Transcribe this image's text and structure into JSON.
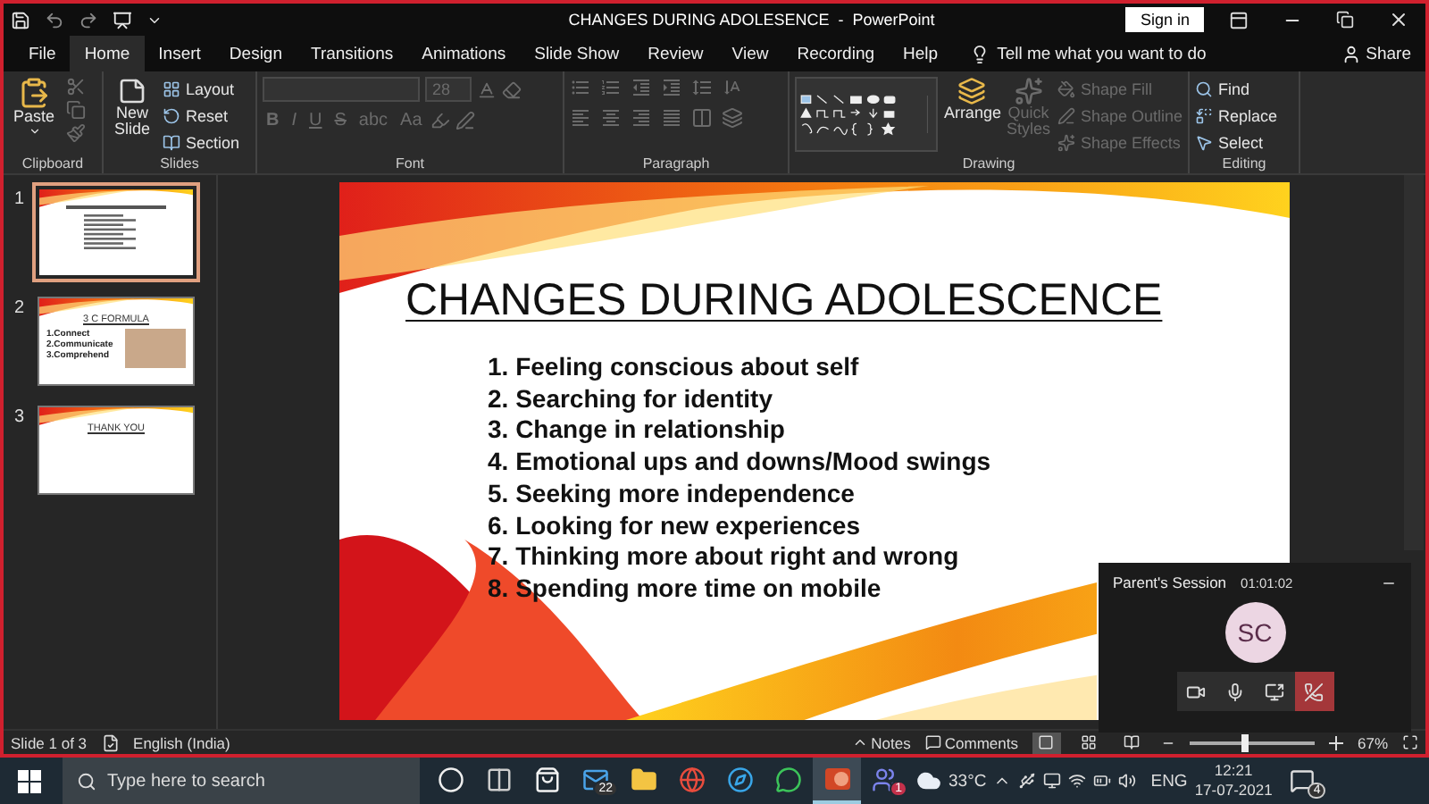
{
  "window": {
    "title": "CHANGES DURING ADOLESENCE  -  PowerPoint",
    "sign_in": "Sign in"
  },
  "tabs": [
    {
      "label": "File",
      "selected": false
    },
    {
      "label": "Home",
      "selected": true
    },
    {
      "label": "Insert",
      "selected": false
    },
    {
      "label": "Design",
      "selected": false
    },
    {
      "label": "Transitions",
      "selected": false
    },
    {
      "label": "Animations",
      "selected": false
    },
    {
      "label": "Slide Show",
      "selected": false
    },
    {
      "label": "Review",
      "selected": false
    },
    {
      "label": "View",
      "selected": false
    },
    {
      "label": "Recording",
      "selected": false
    },
    {
      "label": "Help",
      "selected": false
    }
  ],
  "tell_me": "Tell me what you want to do",
  "share": "Share",
  "ribbon": {
    "clipboard": {
      "label": "Clipboard",
      "paste": "Paste"
    },
    "slides": {
      "label": "Slides",
      "new_slide": "New Slide",
      "items": [
        "Layout",
        "Reset",
        "Section"
      ]
    },
    "font": {
      "label": "Font",
      "size": "28",
      "styles": [
        "B",
        "I",
        "U",
        "S",
        "abc"
      ],
      "case": "Aa",
      "disabled": true
    },
    "paragraph": {
      "label": "Paragraph",
      "disabled": true
    },
    "drawing": {
      "label": "Drawing",
      "arrange": "Arrange",
      "quick_styles": {
        "label": "Quick Styles",
        "disabled": true
      },
      "items": [
        {
          "label": "Shape Fill",
          "disabled": true
        },
        {
          "label": "Shape Outline",
          "disabled": true
        },
        {
          "label": "Shape Effects",
          "disabled": true
        }
      ]
    },
    "editing": {
      "label": "Editing",
      "items": [
        "Find",
        "Replace",
        "Select"
      ]
    }
  },
  "thumbnails": [
    {
      "number": "1",
      "selected": true,
      "kind": "lines"
    },
    {
      "number": "2",
      "selected": false,
      "kind": "list",
      "title": "3 C FORMULA",
      "items": [
        "1.Connect",
        "2.Communicate",
        "3.Comprehend"
      ]
    },
    {
      "number": "3",
      "selected": false,
      "kind": "title",
      "title": "THANK YOU"
    }
  ],
  "slide": {
    "title": "CHANGES DURING ADOLESCENCE",
    "items": [
      "1. Feeling conscious about self",
      "2. Searching for identity",
      "3. Change in relationship",
      "4. Emotional ups and downs/Mood swings",
      "5. Seeking more independence",
      "6. Looking for new experiences",
      "7. Thinking more about right and wrong",
      "8. Spending more time on mobile"
    ]
  },
  "call": {
    "title": "Parent's Session",
    "duration": "01:01:02",
    "initials": "SC"
  },
  "status_bar": {
    "slide": "Slide 1 of 3",
    "language": "English (India)",
    "notes": "Notes",
    "comments": "Comments",
    "views": [
      {
        "selected": true
      },
      {
        "selected": false
      },
      {
        "selected": false
      }
    ],
    "zoom": {
      "level": 0.45
    },
    "zoom_label": "67%"
  },
  "taskbar": {
    "search_placeholder": "Type here to search",
    "apps": [
      {
        "kind": "circle",
        "active": false
      },
      {
        "kind": "taskview",
        "active": false
      },
      {
        "kind": "store",
        "active": false
      },
      {
        "kind": "mail",
        "active": false,
        "badge": "22"
      },
      {
        "kind": "folder",
        "active": false
      },
      {
        "kind": "globe",
        "active": false
      },
      {
        "kind": "compass",
        "active": false
      },
      {
        "kind": "chat",
        "active": false
      },
      {
        "kind": "slides",
        "active": true
      },
      {
        "kind": "team",
        "active": false,
        "badge": "1"
      }
    ],
    "weather": "33°C",
    "language": "ENG",
    "time": "12:21",
    "date": "17-07-2021",
    "notifications": "4"
  }
}
